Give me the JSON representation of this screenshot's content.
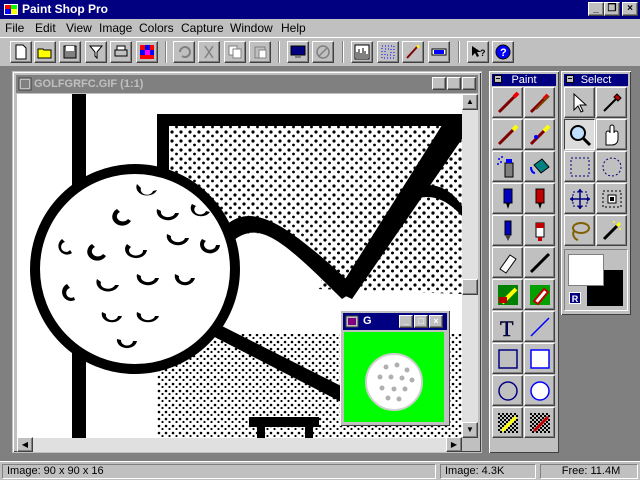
{
  "app": {
    "title": "Paint Shop Pro"
  },
  "menu": [
    "File",
    "Edit",
    "View",
    "Image",
    "Colors",
    "Capture",
    "Window",
    "Help"
  ],
  "image_window": {
    "title": "GOLFGRFC.GIF (1:1)"
  },
  "preview_window": {
    "title": "G"
  },
  "paint_palette": {
    "title": "Paint"
  },
  "select_palette": {
    "title": "Select"
  },
  "colors": {
    "title_active": "#000080",
    "title_inactive": "#808080",
    "preview_bg": "#00ff00",
    "foreground": "#ffffff",
    "background": "#000000"
  },
  "status": {
    "image_info": "Image: 90 x 90 x 16",
    "image_size": "Image: 4.3K",
    "free_mem": "Free: 11.4M"
  },
  "toolbar_icons": [
    "new-icon",
    "open-icon",
    "save-icon",
    "filter-icon",
    "print-icon",
    "palette-icon",
    "undo-icon",
    "cut-icon",
    "copy-icon",
    "paste-icon",
    "screen-icon",
    "noentry-icon",
    "histogram-icon",
    "grid-icon",
    "brush-icon",
    "ruler-icon",
    "help-arrow-icon",
    "help-icon"
  ],
  "paint_tools": [
    "paintbrush-icon",
    "clone-brush-icon",
    "color-replacer-icon",
    "retouch-icon",
    "airbrush-icon",
    "flood-fill-icon",
    "marker-icon",
    "red-marker-icon",
    "pen-icon",
    "dropper-bottle-icon",
    "eraser-icon",
    "line-draw-icon",
    "picture-tube-icon",
    "gradient-eraser-icon",
    "text-icon",
    "line-icon",
    "rectangle-icon",
    "filled-rectangle-icon",
    "ellipse-icon",
    "filled-ellipse-icon",
    "pattern-icon",
    "pattern-two-icon"
  ],
  "select_tools": [
    "arrow-icon",
    "eyedropper-icon",
    "zoom-icon",
    "hand-icon",
    "rect-select-icon",
    "ellipse-select-icon",
    "move-icon",
    "crop-icon",
    "lasso-icon",
    "magic-wand-icon"
  ]
}
